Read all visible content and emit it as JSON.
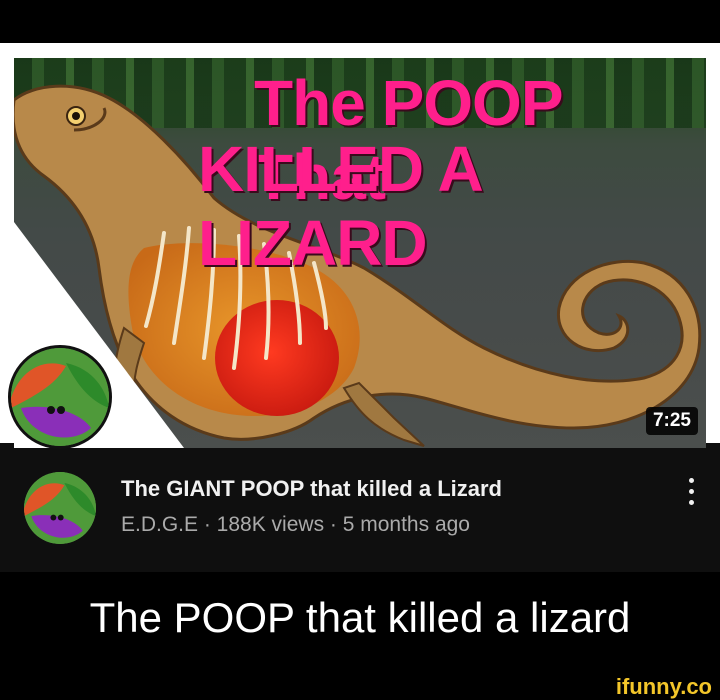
{
  "video": {
    "thumbnail_title_line1": "The POOP That",
    "thumbnail_title_line2": "KILLED A LIZARD",
    "duration": "7:25",
    "title": "The GIANT POOP that killed a Lizard",
    "channel_meta": "E.D.G.E · 188K views · 5 months ago"
  },
  "caption": "The POOP that killed a lizard",
  "watermark": "ifunny.co",
  "colors": {
    "thumbnail_title": "#ff1f8c",
    "channel_meta": "#aaaaaa",
    "watermark": "#f3c62a"
  },
  "icons": [
    "channel-avatar-icon",
    "more-options-icon"
  ]
}
